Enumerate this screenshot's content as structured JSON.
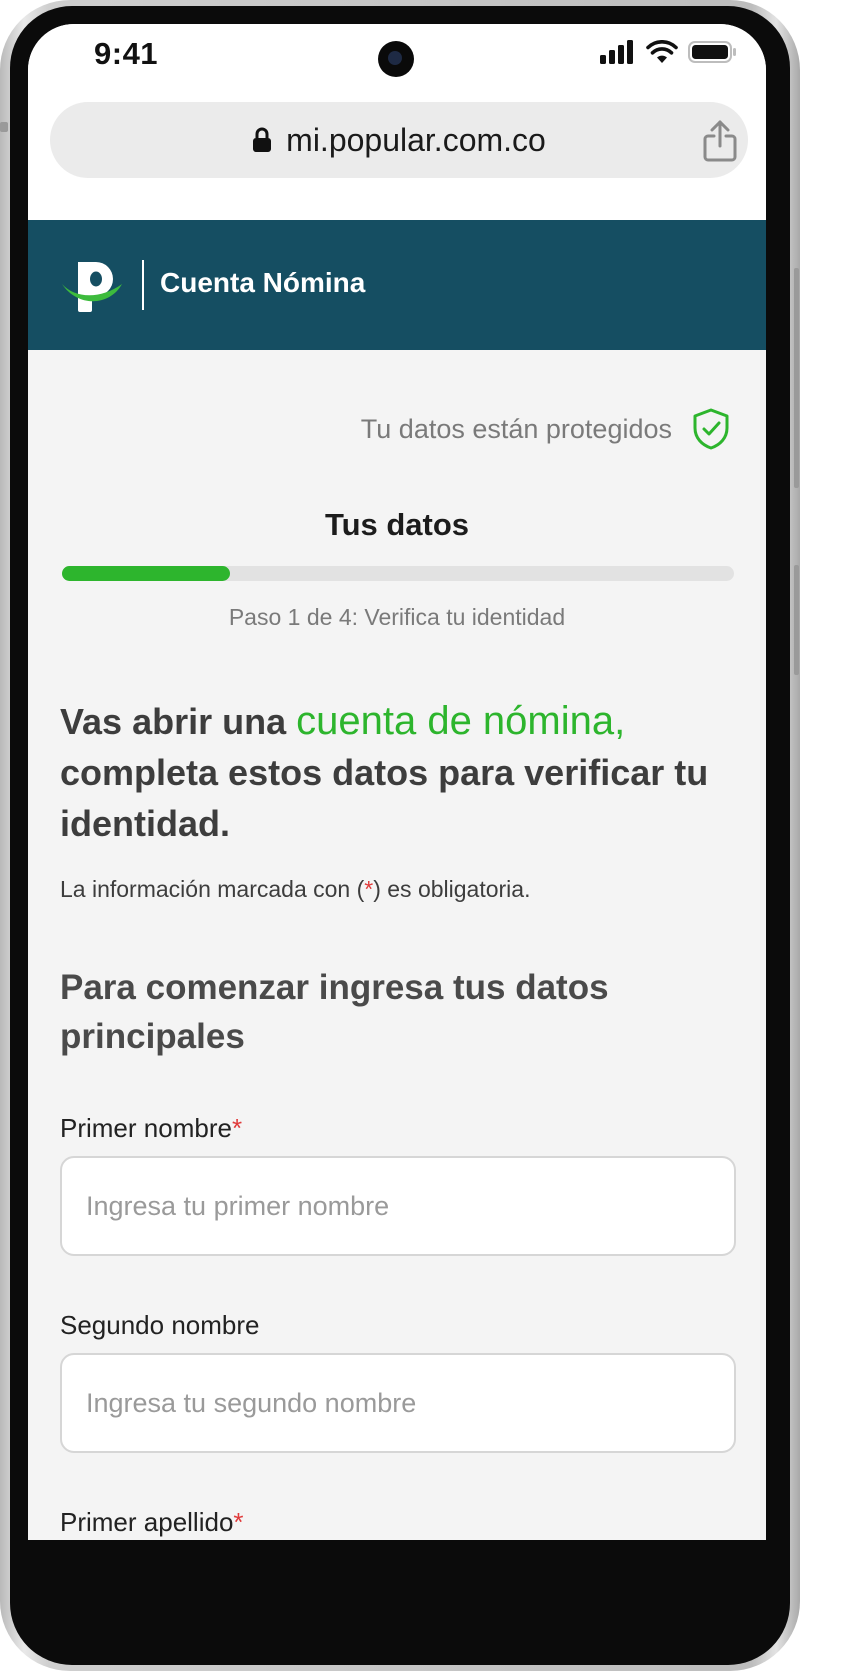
{
  "status_bar": {
    "time": "9:41"
  },
  "browser": {
    "url": "mi.popular.com.co"
  },
  "header": {
    "title": "Cuenta Nómina"
  },
  "security": {
    "text": "Tu datos están protegidos"
  },
  "page": {
    "title": "Tus datos",
    "progress_fraction": 0.25,
    "step": "Paso 1 de 4: Verifica tu identidad"
  },
  "intro": {
    "prefix": "Vas abrir una ",
    "accent": "cuenta de nómina,",
    "suffix": " completa estos datos para verificar tu identidad."
  },
  "required_note": {
    "before": "La información marcada con (",
    "star": "*",
    "after": ") es obligatoria."
  },
  "form": {
    "heading": "Para comenzar ingresa tus datos principales",
    "fields": [
      {
        "label": "Primer nombre",
        "required": "*",
        "placeholder": "Ingresa tu primer nombre"
      },
      {
        "label": "Segundo nombre",
        "required": "",
        "placeholder": "Ingresa tu segundo nombre"
      },
      {
        "label": "Primer apellido",
        "required": "*",
        "placeholder": ""
      }
    ]
  },
  "colors": {
    "header_bg": "#154e62",
    "accent_green": "#2db52d",
    "required_red": "#e03a3a"
  }
}
